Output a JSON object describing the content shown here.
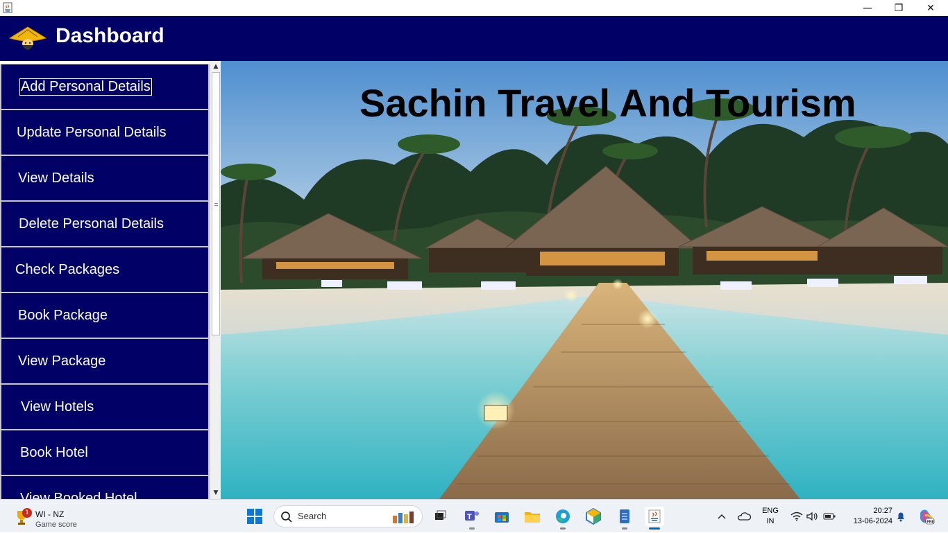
{
  "window": {
    "app_icon": "java-icon",
    "controls": {
      "minimize": "—",
      "restore": "❐",
      "close": "✕"
    }
  },
  "header": {
    "title": "Dashboard",
    "logo": "traveler-hat-logo",
    "bg_color": "#000066"
  },
  "sidebar": {
    "items": [
      {
        "label": "Add Personal Details",
        "focused": true
      },
      {
        "label": "Update Personal Details"
      },
      {
        "label": "View Details"
      },
      {
        "label": "Delete Personal Details"
      },
      {
        "label": "Check Packages"
      },
      {
        "label": "Book Package"
      },
      {
        "label": "View Package"
      },
      {
        "label": "View Hotels"
      },
      {
        "label": "Book Hotel"
      },
      {
        "label": "View Booked Hotel"
      }
    ]
  },
  "hero": {
    "headline": "Sachin Travel And Tourism",
    "image": "tropical-beach-resort-photo"
  },
  "taskbar": {
    "widget": {
      "badge": "1",
      "line1": "WI - NZ",
      "line2": "Game score",
      "icon": "trophy-icon"
    },
    "search_placeholder": "Search",
    "apps": [
      "start-icon",
      "task-view-icon",
      "teams-icon",
      "store-icon",
      "file-explorer-icon",
      "edge-icon",
      "app-cube-icon",
      "notepad-icon",
      "java-app-icon"
    ],
    "tray": {
      "lang_line1": "ENG",
      "lang_line2": "IN",
      "time": "20:27",
      "date": "13-06-2024"
    }
  }
}
